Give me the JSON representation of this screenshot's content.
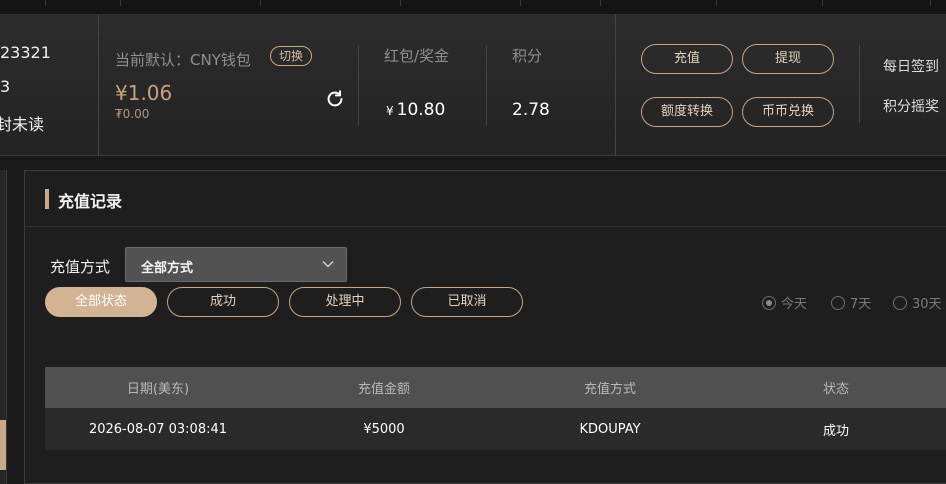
{
  "user": {
    "id_fragment": "23321",
    "level_fragment": "3",
    "unread_fragment": "封未读"
  },
  "wallet": {
    "default_label": "当前默认：CNY钱包",
    "switch_label": "切换",
    "balance": "¥1.06",
    "balance_sub": "₮0.00"
  },
  "bonus": {
    "label": "红包/奖金",
    "currency": "¥",
    "value": "10.80"
  },
  "points": {
    "label": "积分",
    "value": "2.78"
  },
  "actions": {
    "deposit": "充值",
    "withdraw": "提现",
    "quota_transfer": "额度转换",
    "coin_exchange": "币币兑换"
  },
  "side_links": {
    "daily_signin": "每日签到",
    "points_lottery": "积分摇奖"
  },
  "panel": {
    "title": "充值记录",
    "method_label": "充值方式",
    "method_selected": "全部方式",
    "status_filters": [
      "全部状态",
      "成功",
      "处理中",
      "已取消"
    ],
    "active_status_index": 0,
    "date_ranges": [
      "今天",
      "7天",
      "30天"
    ],
    "active_range_index": 0
  },
  "table": {
    "headers": [
      "日期(美东)",
      "充值金额",
      "充值方式",
      "状态"
    ],
    "rows": [
      [
        "2026-08-07 03:08:41",
        "¥5000",
        "KDOUPAY",
        "成功"
      ]
    ]
  },
  "colors": {
    "accent": "#c9a987",
    "active_pill": "#d2b393",
    "balance": "#c9a27d"
  }
}
